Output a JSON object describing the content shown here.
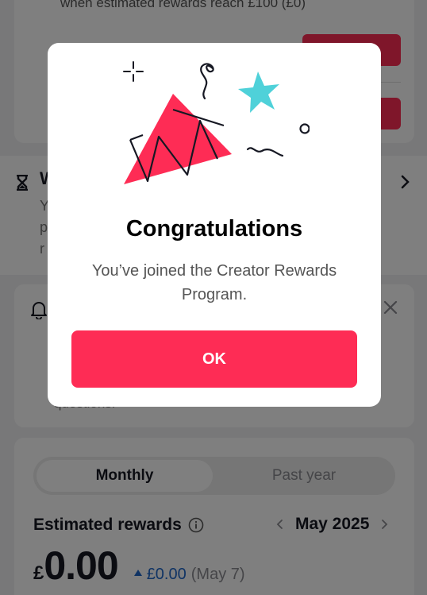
{
  "background": {
    "top_card": {
      "partial_text": "when estimated rewards reach £100 (£0)"
    },
    "section": {
      "title_partial": "W",
      "line_partials": [
        "Y",
        "p",
        "r"
      ]
    },
    "notice": {
      "tail_text": "questions."
    },
    "rewards": {
      "tabs": [
        {
          "label": "Monthly",
          "active": true
        },
        {
          "label": "Past year",
          "active": false
        }
      ],
      "estimated_label": "Estimated rewards",
      "month": "May 2025",
      "currency": "£",
      "amount": "0.00",
      "change_value": "£0.00",
      "change_date": "(May 7)"
    }
  },
  "modal": {
    "title": "Congratulations",
    "body": "You’ve joined the Creator Rewards Program.",
    "ok_label": "OK"
  },
  "colors": {
    "accent": "#fe2c55",
    "teal": "#4fd1d9",
    "link_blue": "#1f67c9"
  }
}
